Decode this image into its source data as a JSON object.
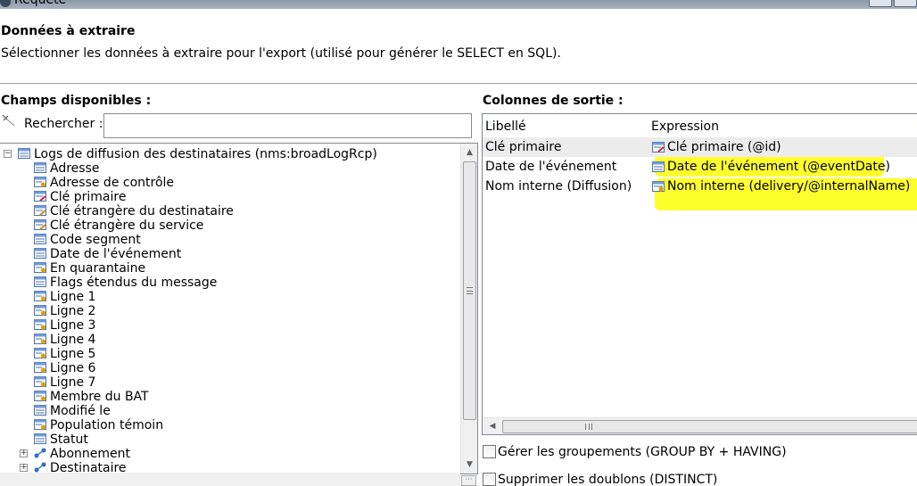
{
  "window": {
    "title": "Requête"
  },
  "header": {
    "title": "Données à extraire",
    "description": "Sélectionner les données à extraire pour l'export (utilisé pour générer le SELECT en SQL)."
  },
  "available": {
    "label": "Champs disponibles :",
    "search_label": "Rechercher :",
    "search_value": "",
    "root": "Logs de diffusion des destinataires (nms:broadLogRcp)",
    "items": [
      {
        "label": "Adresse",
        "icon": "field-icon"
      },
      {
        "label": "Adresse de contrôle",
        "icon": "field-gear-icon"
      },
      {
        "label": "Clé primaire",
        "icon": "primary-key-icon"
      },
      {
        "label": "Clé étrangère du destinataire",
        "icon": "foreign-key-icon"
      },
      {
        "label": "Clé étrangère du service",
        "icon": "foreign-key-icon"
      },
      {
        "label": "Code segment",
        "icon": "field-icon"
      },
      {
        "label": "Date de l'événement",
        "icon": "field-icon"
      },
      {
        "label": "En quarantaine",
        "icon": "field-gear-icon"
      },
      {
        "label": "Flags étendus du message",
        "icon": "field-icon"
      },
      {
        "label": "Ligne 1",
        "icon": "field-gear-icon"
      },
      {
        "label": "Ligne 2",
        "icon": "field-gear-icon"
      },
      {
        "label": "Ligne 3",
        "icon": "field-gear-icon"
      },
      {
        "label": "Ligne 4",
        "icon": "field-gear-icon"
      },
      {
        "label": "Ligne 5",
        "icon": "field-gear-icon"
      },
      {
        "label": "Ligne 6",
        "icon": "field-gear-icon"
      },
      {
        "label": "Ligne 7",
        "icon": "field-gear-icon"
      },
      {
        "label": "Membre du BAT",
        "icon": "field-gear-icon"
      },
      {
        "label": "Modifié le",
        "icon": "field-icon"
      },
      {
        "label": "Population témoin",
        "icon": "field-gear-icon"
      },
      {
        "label": "Statut",
        "icon": "field-icon"
      },
      {
        "label": "Abonnement",
        "icon": "link-icon"
      },
      {
        "label": "Destinataire",
        "icon": "link-icon"
      }
    ]
  },
  "output": {
    "label": "Colonnes de sortie :",
    "columns": [
      "Libellé",
      "Expression"
    ],
    "rows": [
      {
        "label": "Clé primaire",
        "expression": "Clé primaire (@id)"
      },
      {
        "label": "Date de l'événement",
        "expression": "Date de l'événement (@eventDate)"
      },
      {
        "label": "Nom interne (Diffusion)",
        "expression": "Nom interne (delivery/@internalName)"
      }
    ]
  },
  "options": {
    "group_by": "Gérer les groupements (GROUP BY + HAVING)",
    "distinct": "Supprimer les doublons (DISTINCT)"
  },
  "colors": {
    "highlight": "#ffff2e",
    "selection": "#ececec"
  }
}
